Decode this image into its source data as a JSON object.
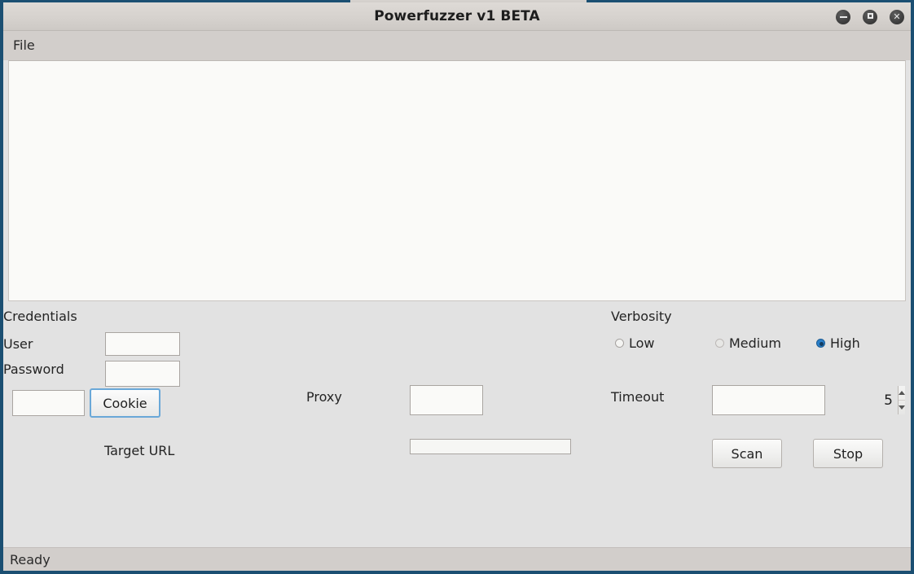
{
  "window": {
    "title": "Powerfuzzer v1 BETA",
    "controls": {
      "minimize_label": "",
      "maximize_label": "",
      "close_label": "✕"
    },
    "border_color": "#1b4f72",
    "titlebar_color": "#d6d2ce"
  },
  "menubar": {
    "items": [
      {
        "label": "File"
      }
    ]
  },
  "log_panel": {
    "content": "",
    "background_color": "#fafaf8"
  },
  "controls": {
    "credentials": {
      "group_label": "Credentials",
      "user_label": "User",
      "user_value": "",
      "user_placeholder": "",
      "password_label": "Password",
      "password_value": "",
      "password_placeholder": "",
      "cookie_value": "",
      "cookie_placeholder": "",
      "cookie_button_label": "Cookie",
      "cookie_button_focus_color": "#6aa8d8"
    },
    "proxy": {
      "label": "Proxy",
      "value": "",
      "placeholder": ""
    },
    "target_url": {
      "label": "Target URL",
      "value": "",
      "placeholder": ""
    },
    "verbosity": {
      "group_label": "Verbosity",
      "selected": "High",
      "selected_color": "#2a7fc9",
      "options": [
        {
          "label": "Low",
          "selected": false,
          "state": "normal"
        },
        {
          "label": "Medium",
          "selected": false,
          "state": "dim"
        },
        {
          "label": "High",
          "selected": true,
          "state": "normal"
        }
      ]
    },
    "timeout": {
      "label": "Timeout",
      "value": "5"
    },
    "actions": {
      "scan_label": "Scan",
      "stop_label": "Stop"
    }
  },
  "statusbar": {
    "text": "Ready"
  }
}
